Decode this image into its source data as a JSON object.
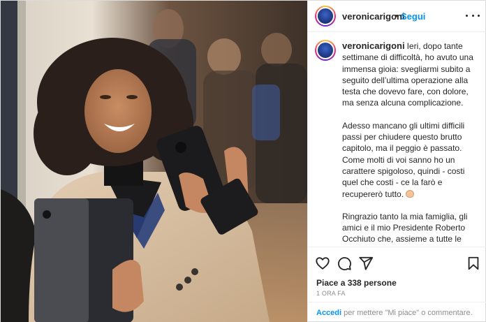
{
  "post": {
    "username": "veronicarigoni",
    "separator": "•",
    "follow_label": "Segui",
    "caption": {
      "paragraphs": [
        "Ieri, dopo tante settimane di difficoltà, ho avuto una immensa gioia: svegliarmi subito a seguito dell’ultima operazione alla testa che dovevo fare, con dolore, ma senza alcuna complicazione.",
        "Adesso mancano gli ultimi difficili passi per chiudere questo brutto capitolo, ma il peggio è passato. Come molti di voi sanno ho un carattere spigoloso, quindi - costi quel che costi - ce la farò e recupererò tutto.",
        "Ringrazio tanto la mia famiglia, gli amici e il mio Presidente Roberto Occhiuto che, assieme a tutte le persone care che fanno parte della nostra vita, mi sono sempre stati vicini anche nei giorni più bui dove difficilmente..."
      ]
    },
    "likes": "Piace a 338 persone",
    "time_ago": "1 ORA FA",
    "footer": {
      "login_link": "Accedi",
      "login_suffix": " per mettere \"Mi piace\" o commentare."
    },
    "icons": {
      "options": "more-options-icon",
      "like": "heart-icon",
      "comment": "comment-icon",
      "share": "share-icon",
      "save": "bookmark-icon",
      "emoji": "fist-emoji"
    },
    "colors": {
      "link": "#0095f6",
      "text": "#262626",
      "muted": "#8e8e8e",
      "border": "#dbdbdb"
    }
  }
}
